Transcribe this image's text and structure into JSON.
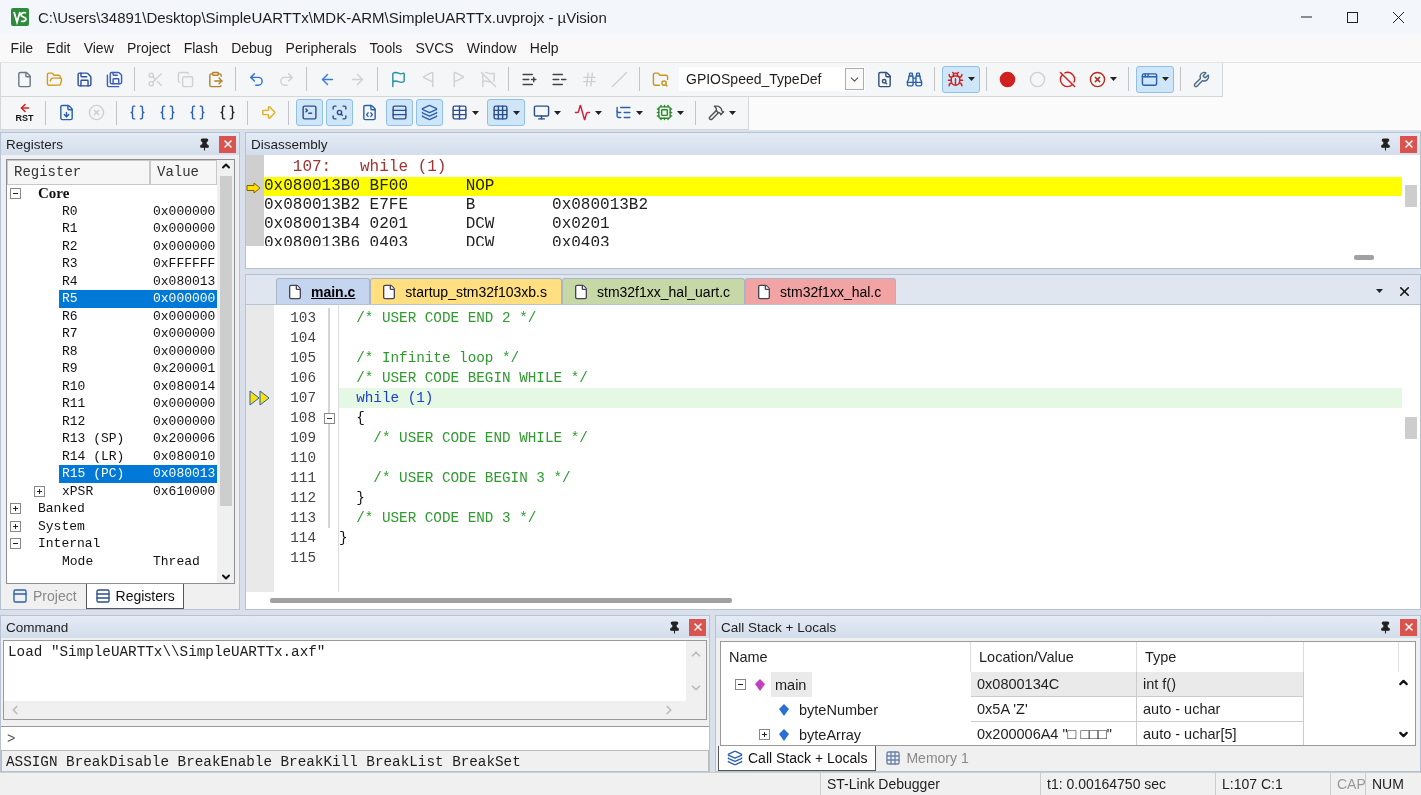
{
  "window": {
    "title": "C:\\Users\\34891\\Desktop\\SimpleUARTTx\\MDK-ARM\\SimpleUARTTx.uvprojx - µVision"
  },
  "menu": [
    "File",
    "Edit",
    "View",
    "Project",
    "Flash",
    "Debug",
    "Peripherals",
    "Tools",
    "SVCS",
    "Window",
    "Help"
  ],
  "toolbars": [
    {
      "items": [
        {
          "kind": "new",
          "disabled": false,
          "active": false,
          "dropdown": false
        },
        {
          "kind": "open",
          "disabled": false,
          "active": false,
          "dropdown": false
        },
        {
          "kind": "save",
          "disabled": false,
          "active": false,
          "dropdown": false
        },
        {
          "kind": "save-all",
          "disabled": false,
          "active": false,
          "dropdown": false
        },
        {
          "kind": "separator"
        },
        {
          "kind": "cut",
          "disabled": true,
          "active": false,
          "dropdown": false
        },
        {
          "kind": "copy",
          "disabled": true,
          "active": false,
          "dropdown": false
        },
        {
          "kind": "paste",
          "disabled": false,
          "active": false,
          "dropdown": false
        },
        {
          "kind": "separator"
        },
        {
          "kind": "undo",
          "disabled": false,
          "active": false,
          "dropdown": false
        },
        {
          "kind": "redo",
          "disabled": true,
          "active": false,
          "dropdown": false
        },
        {
          "kind": "separator"
        },
        {
          "kind": "back",
          "disabled": false,
          "active": false,
          "dropdown": false
        },
        {
          "kind": "forward",
          "disabled": true,
          "active": false,
          "dropdown": false
        },
        {
          "kind": "separator"
        },
        {
          "kind": "bookmark",
          "disabled": false,
          "active": false,
          "dropdown": false
        },
        {
          "kind": "bookmark-prev",
          "disabled": true,
          "active": false,
          "dropdown": false
        },
        {
          "kind": "bookmark-next",
          "disabled": true,
          "active": false,
          "dropdown": false
        },
        {
          "kind": "bookmark-clear",
          "disabled": true,
          "active": false,
          "dropdown": false
        },
        {
          "kind": "separator"
        },
        {
          "kind": "indent",
          "disabled": false,
          "active": false,
          "dropdown": false
        },
        {
          "kind": "unindent",
          "disabled": false,
          "active": false,
          "dropdown": false
        },
        {
          "kind": "comment",
          "disabled": true,
          "active": false,
          "dropdown": false
        },
        {
          "kind": "uncomment",
          "disabled": true,
          "active": false,
          "dropdown": false
        },
        {
          "kind": "separator"
        },
        {
          "kind": "find-in-files",
          "disabled": false,
          "active": false,
          "dropdown": false
        },
        {
          "kind": "combo",
          "value": "GPIOSpeed_TypeDef"
        },
        {
          "kind": "find",
          "disabled": false,
          "active": false,
          "dropdown": false
        },
        {
          "kind": "incremental-find",
          "disabled": false,
          "active": false,
          "dropdown": false
        },
        {
          "kind": "separator"
        },
        {
          "kind": "debug",
          "disabled": false,
          "active": true,
          "dropdown": true
        },
        {
          "kind": "separator"
        },
        {
          "kind": "breakpoint",
          "disabled": false,
          "active": false,
          "dropdown": false
        },
        {
          "kind": "breakpoint-enable",
          "disabled": true,
          "active": false,
          "dropdown": false
        },
        {
          "kind": "breakpoint-disable-all",
          "disabled": false,
          "active": false,
          "dropdown": false
        },
        {
          "kind": "breakpoint-kill-all",
          "disabled": false,
          "active": false,
          "dropdown": true
        },
        {
          "kind": "separator"
        },
        {
          "kind": "window",
          "disabled": false,
          "active": true,
          "dropdown": true
        },
        {
          "kind": "separator"
        },
        {
          "kind": "configure",
          "disabled": false,
          "active": false,
          "dropdown": false
        }
      ]
    },
    {
      "items": [
        {
          "kind": "reset",
          "label": "RST",
          "disabled": false,
          "active": false,
          "dropdown": false
        },
        {
          "kind": "separator"
        },
        {
          "kind": "run",
          "disabled": false,
          "active": false,
          "dropdown": false
        },
        {
          "kind": "stop",
          "disabled": true,
          "active": false,
          "dropdown": false
        },
        {
          "kind": "separator"
        },
        {
          "kind": "step-into",
          "disabled": false,
          "active": false,
          "dropdown": false
        },
        {
          "kind": "step-over",
          "disabled": false,
          "active": false,
          "dropdown": false
        },
        {
          "kind": "step-out",
          "disabled": false,
          "active": false,
          "dropdown": false
        },
        {
          "kind": "run-to-cursor",
          "disabled": false,
          "active": false,
          "dropdown": false
        },
        {
          "kind": "separator"
        },
        {
          "kind": "show-next",
          "disabled": false,
          "active": false,
          "dropdown": false
        },
        {
          "kind": "separator"
        },
        {
          "kind": "command-window",
          "disabled": false,
          "active": true,
          "dropdown": false
        },
        {
          "kind": "disassembly-window",
          "disabled": false,
          "active": true,
          "dropdown": false
        },
        {
          "kind": "symbols-window",
          "disabled": false,
          "active": false,
          "dropdown": false
        },
        {
          "kind": "registers-window",
          "disabled": false,
          "active": true,
          "dropdown": false
        },
        {
          "kind": "call-stack-window",
          "disabled": false,
          "active": true,
          "dropdown": false
        },
        {
          "kind": "watch-window",
          "disabled": false,
          "active": false,
          "dropdown": true
        },
        {
          "kind": "memory-window",
          "disabled": false,
          "active": true,
          "dropdown": true
        },
        {
          "kind": "serial-window",
          "disabled": false,
          "active": false,
          "dropdown": true
        },
        {
          "kind": "analysis-window",
          "disabled": false,
          "active": false,
          "dropdown": true
        },
        {
          "kind": "trace-window",
          "disabled": false,
          "active": false,
          "dropdown": true
        },
        {
          "kind": "system-viewer",
          "disabled": false,
          "active": false,
          "dropdown": true
        },
        {
          "kind": "separator"
        },
        {
          "kind": "toolbox",
          "disabled": false,
          "active": false,
          "dropdown": true
        }
      ]
    }
  ],
  "registers": {
    "title": "Registers",
    "columns": [
      "Register",
      "Value"
    ],
    "items": [
      {
        "name": "Core",
        "bold": true,
        "expanded": true,
        "selected": false,
        "children": [
          {
            "name": "R0",
            "value": "0x000000",
            "selected": false
          },
          {
            "name": "R1",
            "value": "0x000000",
            "selected": false
          },
          {
            "name": "R2",
            "value": "0x000000",
            "selected": false
          },
          {
            "name": "R3",
            "value": "0xFFFFFF",
            "selected": false
          },
          {
            "name": "R4",
            "value": "0x080013",
            "selected": false
          },
          {
            "name": "R5",
            "value": "0x000000",
            "selected": true
          },
          {
            "name": "R6",
            "value": "0x000000",
            "selected": false
          },
          {
            "name": "R7",
            "value": "0x000000",
            "selected": false
          },
          {
            "name": "R8",
            "value": "0x000000",
            "selected": false
          },
          {
            "name": "R9",
            "value": "0x200001",
            "selected": false
          },
          {
            "name": "R10",
            "value": "0x080014",
            "selected": false
          },
          {
            "name": "R11",
            "value": "0x000000",
            "selected": false
          },
          {
            "name": "R12",
            "value": "0x000000",
            "selected": false
          },
          {
            "name": "R13 (SP)",
            "value": "0x200006",
            "selected": false
          },
          {
            "name": "R14 (LR)",
            "value": "0x080010",
            "selected": false
          },
          {
            "name": "R15 (PC)",
            "value": "0x080013",
            "selected": true
          },
          {
            "name": "xPSR",
            "value": "0x610000",
            "expanded": false,
            "selected": false
          }
        ]
      },
      {
        "name": "Banked",
        "bold": false,
        "expanded": false,
        "selected": false
      },
      {
        "name": "System",
        "bold": false,
        "expanded": false,
        "selected": false
      },
      {
        "name": "Internal",
        "bold": false,
        "expanded": true,
        "selected": false,
        "children": [
          {
            "name": "Mode",
            "value": "Thread",
            "selected": false
          }
        ]
      }
    ],
    "tabs": [
      {
        "label": "Project",
        "kind": "project",
        "selected": false
      },
      {
        "label": "Registers",
        "kind": "registers",
        "selected": true
      }
    ]
  },
  "disassembly": {
    "title": "Disassembly",
    "lines": [
      {
        "kind": "source",
        "text": "   107:   while (1)",
        "current": false
      },
      {
        "kind": "instruction",
        "text": "0x080013B0 BF00      NOP",
        "current": true
      },
      {
        "kind": "instruction",
        "text": "0x080013B2 E7FE      B        0x080013B2",
        "current": false
      },
      {
        "kind": "instruction",
        "text": "0x080013B4 0201      DCW      0x0201",
        "current": false
      },
      {
        "kind": "instruction",
        "text": "0x080013B6 0403      DCW      0x0403",
        "current": false
      }
    ]
  },
  "editor": {
    "tabs": [
      {
        "label": "main.c",
        "color": "#c5d5ef",
        "selected": true
      },
      {
        "label": "startup_stm32f103xb.s",
        "color": "#ffdf80",
        "selected": false
      },
      {
        "label": "stm32f1xx_hal_uart.c",
        "color": "#c6d8a6",
        "selected": false
      },
      {
        "label": "stm32f1xx_hal.c",
        "color": "#f2a3a3",
        "selected": false
      }
    ],
    "lines": [
      {
        "number": "103",
        "kind": "comment",
        "text": "  /* USER CODE END 2 */",
        "fold": false,
        "current": false
      },
      {
        "number": "104",
        "fold": false,
        "current": false
      },
      {
        "number": "105",
        "kind": "comment",
        "text": "  /* Infinite loop */",
        "fold": false,
        "current": false
      },
      {
        "number": "106",
        "kind": "comment",
        "text": "  /* USER CODE BEGIN WHILE */",
        "fold": false,
        "current": false
      },
      {
        "number": "107",
        "kind": "keyword",
        "text": "  while (1)",
        "fold": false,
        "current": true
      },
      {
        "number": "108",
        "kind": "plain",
        "text": "  {",
        "fold": true,
        "current": false
      },
      {
        "number": "109",
        "kind": "comment",
        "text": "    /* USER CODE END WHILE */",
        "fold": false,
        "current": false
      },
      {
        "number": "110",
        "fold": false,
        "current": false
      },
      {
        "number": "111",
        "kind": "comment",
        "text": "    /* USER CODE BEGIN 3 */",
        "fold": false,
        "current": false
      },
      {
        "number": "112",
        "kind": "plain",
        "text": "  }",
        "fold": false,
        "current": false
      },
      {
        "number": "113",
        "kind": "comment",
        "text": "  /* USER CODE END 3 */",
        "fold": false,
        "current": false
      },
      {
        "number": "114",
        "kind": "plain",
        "text": "}",
        "fold": false,
        "current": false
      },
      {
        "number": "115",
        "fold": false,
        "current": false
      }
    ]
  },
  "command": {
    "title": "Command",
    "output": [
      "Load \"SimpleUARTTx\\\\SimpleUARTTx.axf\""
    ],
    "prompt": ">",
    "hint": "ASSIGN BreakDisable BreakEnable BreakKill BreakList BreakSet"
  },
  "call_stack": {
    "title": "Call Stack + Locals",
    "columns": [
      "Name",
      "Location/Value",
      "Type"
    ],
    "rows": [
      {
        "name": "main",
        "value": "0x0800134C",
        "type": "int f()",
        "kind": "function",
        "expanded": true,
        "selected": true,
        "children": [
          {
            "name": "byteNumber",
            "value": "0x5A 'Z'",
            "type": "auto - uchar",
            "kind": "variable",
            "selected": false
          },
          {
            "name": "byteArray",
            "value": "0x200006A4 \"□ □□□\"",
            "type": "auto - uchar[5]",
            "kind": "variable",
            "expanded": false,
            "selected": false
          }
        ]
      }
    ],
    "tabs": [
      {
        "label": "Call Stack + Locals",
        "kind": "callstack",
        "selected": true
      },
      {
        "label": "Memory 1",
        "kind": "memory",
        "selected": false
      }
    ]
  },
  "status_bar": {
    "cells": [
      {
        "text": "ST-Link Debugger",
        "kind": "text"
      },
      {
        "text": "t1: 0.00164750 sec",
        "kind": "text"
      },
      {
        "text": "L:107 C:1",
        "kind": "text"
      },
      {
        "text": "CAP",
        "kind": "key",
        "on": false
      },
      {
        "text": "NUM",
        "kind": "key",
        "on": true
      }
    ]
  }
}
